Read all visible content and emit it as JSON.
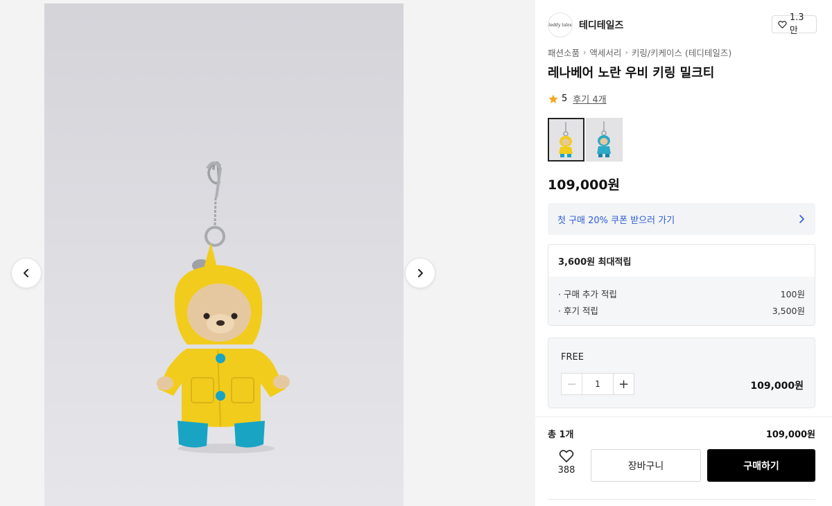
{
  "gallery": {
    "prev_icon": "chevron-left-icon",
    "next_icon": "chevron-right-icon"
  },
  "brand": {
    "logo_text": "teddy tales",
    "name": "테디테일즈",
    "like_icon": "heart-outline-icon",
    "like_count": "1.3만"
  },
  "breadcrumb": [
    {
      "label": "패션소품"
    },
    {
      "label": "액세서리"
    },
    {
      "label": "키링/키케이스 (테디테일즈)"
    }
  ],
  "product": {
    "title": "레나베어 노란 우비 키링 밀크티",
    "rating_icon": "star-icon",
    "rating": "5",
    "reviews": "후기 4개",
    "price": "109,000원",
    "thumbnails": [
      {
        "name": "yellow-raincoat",
        "active": true,
        "coat_color": "#f2cc1c",
        "boot_color": "#1aa4c4"
      },
      {
        "name": "blue-raincoat",
        "active": false,
        "coat_color": "#2ea9c6",
        "boot_color": "#1a85a3"
      }
    ]
  },
  "coupon": {
    "text": "첫 구매 20% 쿠폰 받으러 가기",
    "icon": "chevron-right-icon",
    "color": "#2b5bd7"
  },
  "points": {
    "title": "3,600원 최대적립",
    "rows": [
      {
        "label": "· 구매 추가 적립",
        "value": "100원"
      },
      {
        "label": "· 후기 적립",
        "value": "3,500원"
      }
    ]
  },
  "option": {
    "name": "FREE",
    "quantity": "1",
    "minus_label": "−",
    "plus_label": "+",
    "price": "109,000원"
  },
  "summary": {
    "total_label": "총 1개",
    "total_price": "109,000원"
  },
  "actions": {
    "wish_icon": "heart-outline-icon",
    "wish_count": "388",
    "cart_label": "장바구니",
    "buy_label": "구매하기"
  },
  "colors": {
    "accent": "#2b5bd7",
    "buy_button": "#000000",
    "star": "#f5a623",
    "raincoat": "#f2cc1c",
    "boots": "#1aa4c4"
  }
}
